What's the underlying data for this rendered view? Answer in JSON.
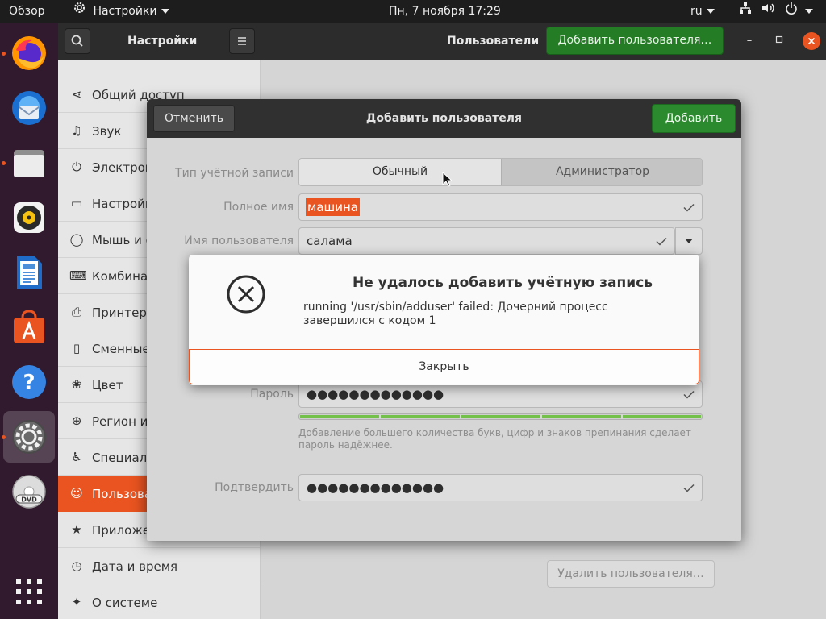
{
  "topbar": {
    "activities": "Обзор",
    "app_menu": "Настройки",
    "clock": "Пн, 7 ноября  17:29",
    "lang": "ru"
  },
  "settings": {
    "header_title": "Настройки",
    "panel_title": "Пользователи",
    "add_user_button": "Добавить пользователя…",
    "remove_user_button": "Удалить пользователя…",
    "sidebar": [
      {
        "label": "Общий доступ",
        "icon": "share-icon"
      },
      {
        "label": "Звук",
        "icon": "music-note-icon"
      },
      {
        "label": "Электропитание",
        "icon": "power-icon"
      },
      {
        "label": "Настройки дисплея",
        "icon": "display-icon"
      },
      {
        "label": "Мышь и сенсорная панель",
        "icon": "mouse-icon"
      },
      {
        "label": "Комбинации клавиш",
        "icon": "keyboard-icon"
      },
      {
        "label": "Принтеры",
        "icon": "printer-icon"
      },
      {
        "label": "Сменные носители",
        "icon": "removable-media-icon"
      },
      {
        "label": "Цвет",
        "icon": "color-icon"
      },
      {
        "label": "Регион и язык",
        "icon": "globe-icon"
      },
      {
        "label": "Специальные возможности",
        "icon": "accessibility-icon"
      },
      {
        "label": "Пользователи",
        "icon": "users-icon",
        "selected": true
      },
      {
        "label": "Приложения по умолчанию",
        "icon": "star-icon"
      },
      {
        "label": "Дата и время",
        "icon": "clock-icon"
      },
      {
        "label": "О системе",
        "icon": "sparkle-icon"
      }
    ]
  },
  "add_user_dialog": {
    "title": "Добавить пользователя",
    "cancel": "Отменить",
    "add": "Добавить",
    "account_type_label": "Тип учётной записи",
    "account_type_normal": "Обычный",
    "account_type_admin": "Администратор",
    "full_name_label": "Полное имя",
    "full_name_value": "машина",
    "username_label": "Имя пользователя",
    "username_value": "салама",
    "password_label": "Пароль",
    "password_value": "●●●●●●●●●●●●●",
    "confirm_label": "Подтвердить",
    "confirm_value": "●●●●●●●●●●●●●",
    "password_hint": "Добавление большего количества букв, цифр и знаков препинания сделает пароль надёжнее.",
    "password_strength": 1.0
  },
  "error_dialog": {
    "title": "Не удалось добавить учётную запись",
    "message": "running '/usr/sbin/adduser' failed: Дочерний процесс завершился с кодом 1",
    "close": "Закрыть"
  },
  "colors": {
    "accent": "#e95420",
    "success": "#2b8a2e",
    "dock": "#311a2e"
  }
}
